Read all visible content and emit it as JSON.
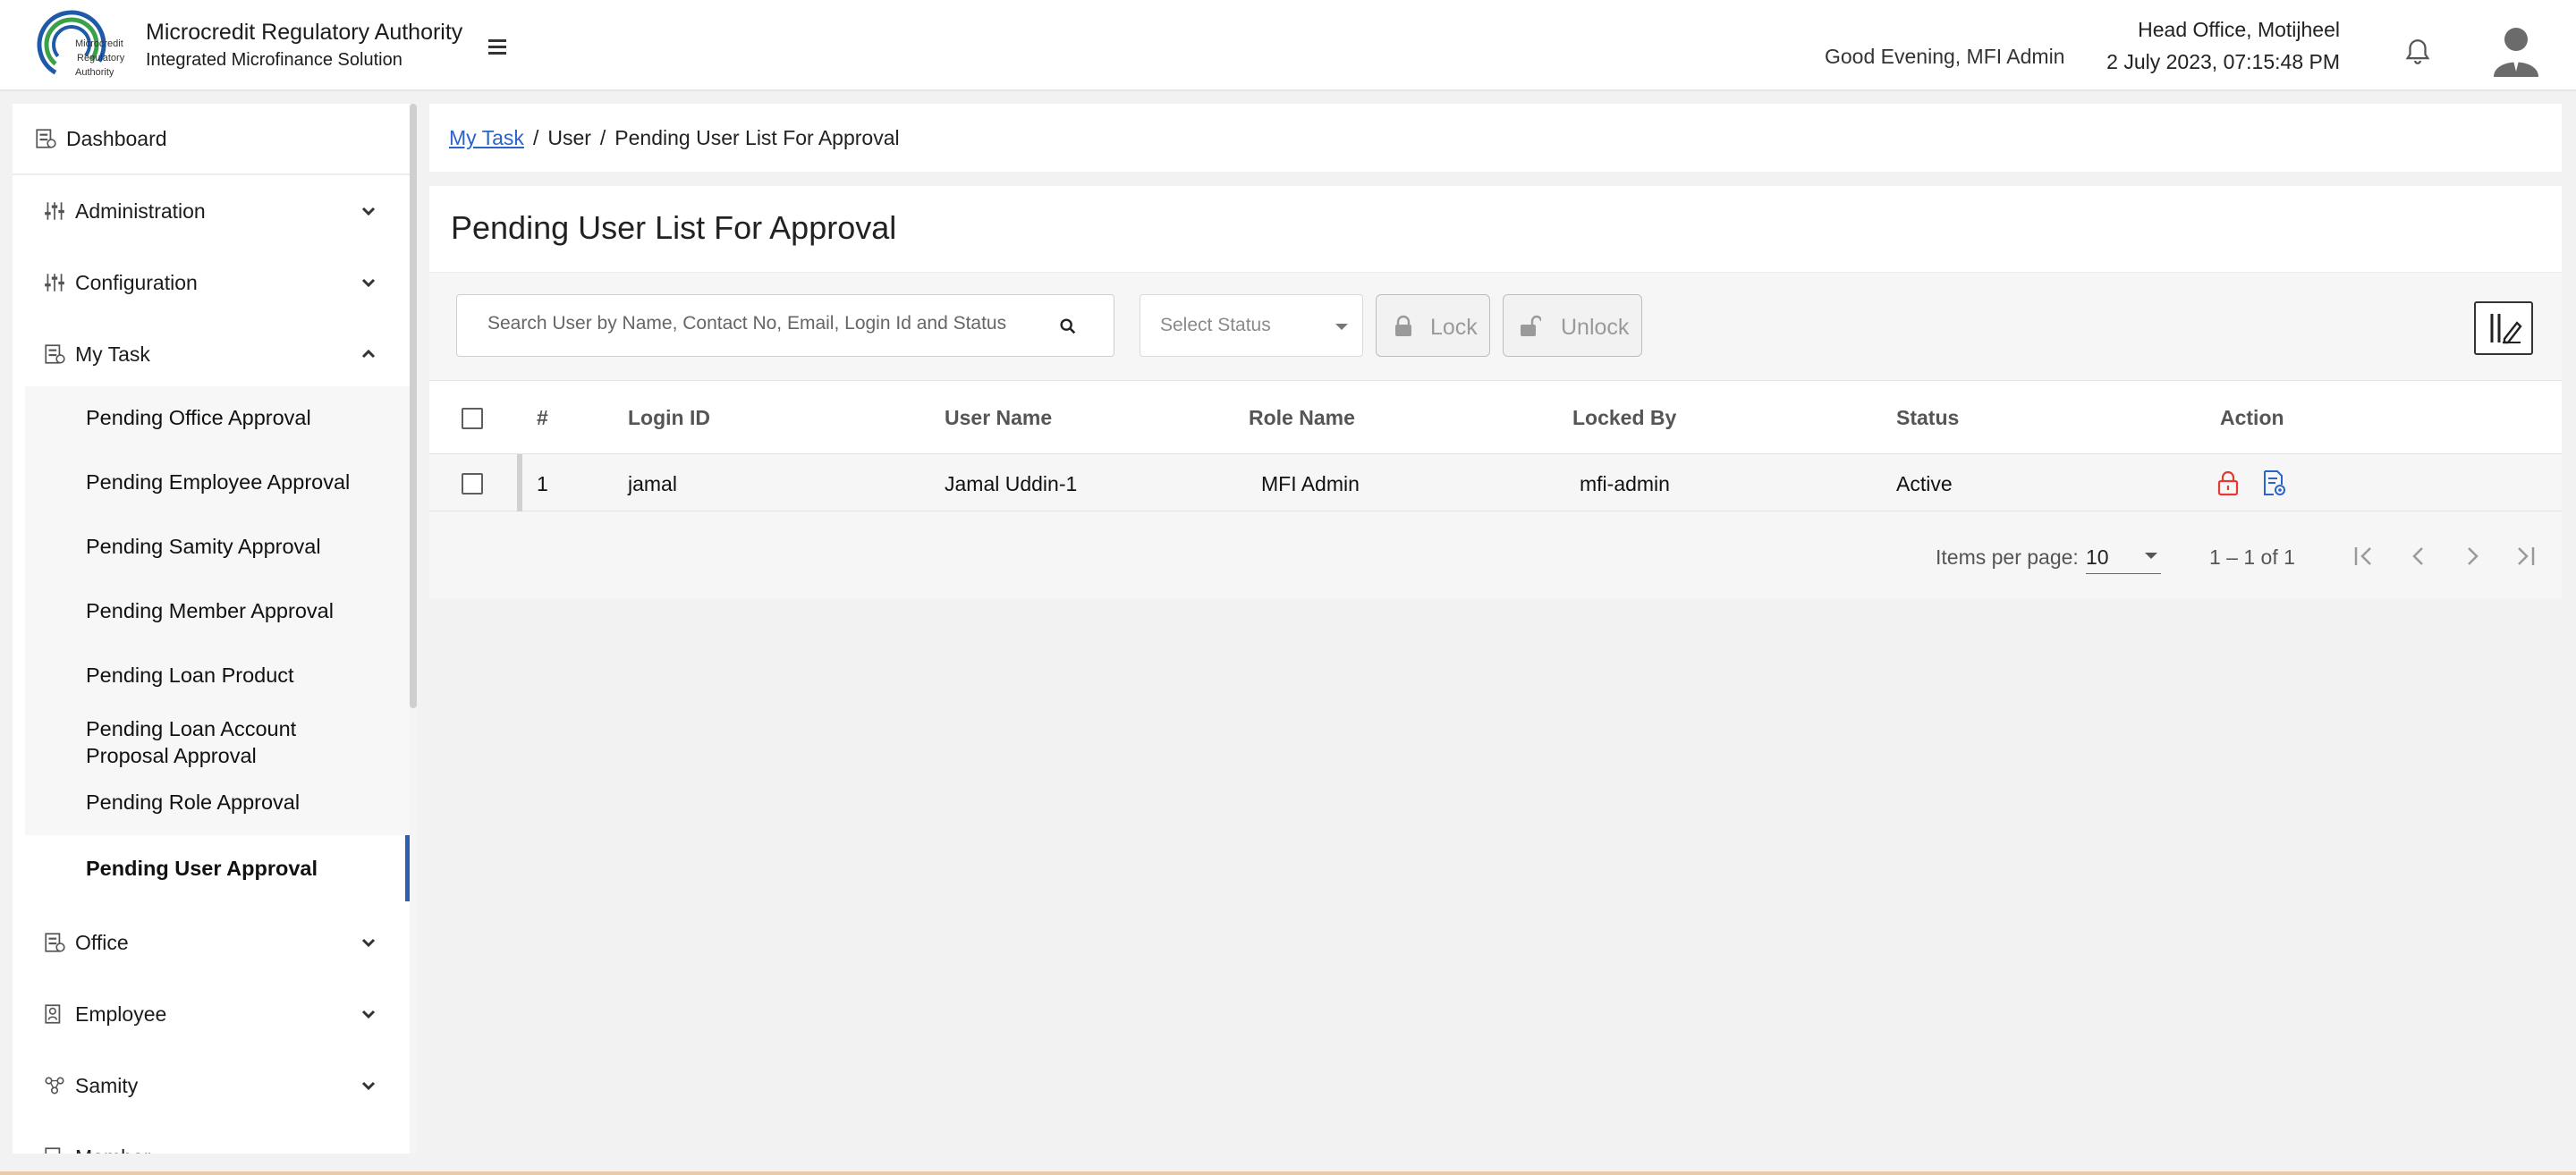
{
  "header": {
    "org_name": "Microcredit Regulatory Authority",
    "org_sub": "Integrated Microfinance Solution",
    "logo_text": [
      "Microcredit",
      "Regulatory",
      "Authority"
    ],
    "greeting": "Good Evening, MFI Admin",
    "office": "Head Office, Motijheel",
    "datetime": "2 July 2023, 07:15:48 PM",
    "icons": [
      "menu-icon",
      "bell-icon",
      "avatar-icon"
    ]
  },
  "sidebar": {
    "dashboard": "Dashboard",
    "items": [
      {
        "label": "Administration",
        "icon": "sliders-icon",
        "expanded": false
      },
      {
        "label": "Configuration",
        "icon": "sliders-icon",
        "expanded": false
      },
      {
        "label": "My Task",
        "icon": "task-icon",
        "expanded": true
      },
      {
        "label": "Office",
        "icon": "office-icon",
        "expanded": false
      },
      {
        "label": "Employee",
        "icon": "employee-icon",
        "expanded": false
      },
      {
        "label": "Samity",
        "icon": "samity-icon",
        "expanded": false
      },
      {
        "label": "Member",
        "icon": "member-icon",
        "expanded": false
      }
    ],
    "my_task_children": [
      "Pending Office Approval",
      "Pending Employee Approval",
      "Pending Samity Approval",
      "Pending Member Approval",
      "Pending Loan Product",
      "Pending Loan Account\nProposal Approval",
      "Pending Role Approval",
      "Pending User Approval"
    ],
    "active_child": "Pending User Approval",
    "accent": "#2c5fad"
  },
  "breadcrumb": {
    "root": "My Task",
    "sep": "/",
    "mid": "User",
    "current": "Pending User List For Approval"
  },
  "page": {
    "title": "Pending User List For Approval",
    "search_placeholder": "Search User by Name, Contact No, Email, Login Id and Status",
    "status_placeholder": "Select Status",
    "lock_label": "Lock",
    "unlock_label": "Unlock"
  },
  "table": {
    "headers": [
      "#",
      "Login ID",
      "User Name",
      "Role Name",
      "Locked By",
      "Status",
      "Action"
    ],
    "rows": [
      {
        "no": "1",
        "login_id": "jamal",
        "user_name": "Jamal Uddin-1",
        "role_name": "MFI Admin",
        "locked_by": "mfi-admin",
        "status": "Active",
        "actions": [
          "lock-icon",
          "view-details-icon"
        ]
      }
    ]
  },
  "paginator": {
    "items_per_page_label": "Items per page:",
    "page_size": "10",
    "range": "1 – 1 of 1"
  },
  "colors": {
    "link": "#2a63c9",
    "lock_action": "#e53935",
    "view_action": "#2a63c9"
  }
}
